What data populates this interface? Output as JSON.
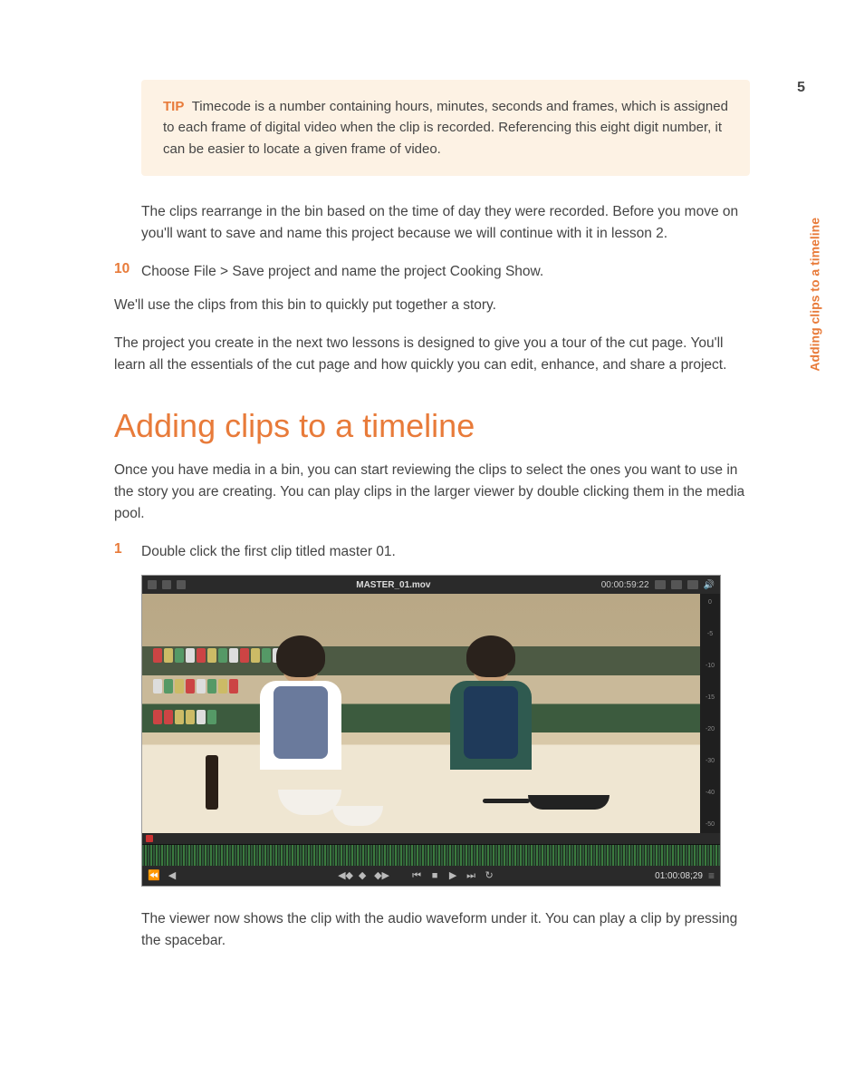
{
  "page_number": "5",
  "side_section_label": "Adding clips to a timeline",
  "tip": {
    "label": "TIP",
    "text": "Timecode is a number containing hours, minutes, seconds and frames, which is assigned to each frame of digital video when the clip is recorded. Referencing this eight digit number, it can be easier to locate a given frame of video."
  },
  "para_rearrange": "The clips rearrange in the bin based on the time of day they were recorded. Before you move on you'll want to save and name this project because we will continue with it in lesson 2.",
  "step10": {
    "num": "10",
    "text": "Choose File > Save project and name the project Cooking Show."
  },
  "para_use_clips": "We'll use the clips from this bin to quickly put together a story.",
  "para_tour": "The project you create in the next two lessons is designed to give you a tour of the cut page. You'll learn all the essentials of the cut page and how quickly you can edit, enhance, and share a project.",
  "heading": "Adding clips to a timeline",
  "para_intro": "Once you have media in a bin, you can start reviewing the clips to select the ones you want to use in the story you are creating. You can play clips in the larger viewer by double clicking them in the media pool.",
  "step1": {
    "num": "1",
    "text": "Double click the first clip titled master 01."
  },
  "editor": {
    "clip_title": "MASTER_01.mov",
    "top_timecode": "00:00:59:22",
    "bottom_timecode": "01:00:08;29",
    "meter": {
      "m0": "0",
      "m5": "-5",
      "m10": "-10",
      "m15": "-15",
      "m20": "-20",
      "m30": "-30",
      "m40": "-40",
      "m50": "-50"
    }
  },
  "para_viewer": "The viewer now shows the clip with the audio waveform under it. You can play a clip by pressing the spacebar."
}
